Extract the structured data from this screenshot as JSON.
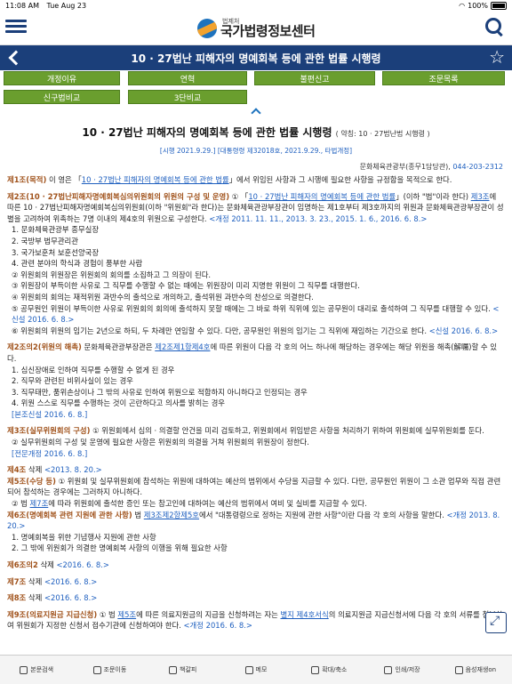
{
  "status": {
    "time": "11:08 AM",
    "date": "Tue Aug 23",
    "battery": "100%"
  },
  "header": {
    "logo_sub": "법제처",
    "logo_main": "국가법령정보센터"
  },
  "titlebar": {
    "title": "10 · 27법난 피해자의 명예회복 등에 관한 법률 시행령"
  },
  "tabs": [
    {
      "label": "개정이유"
    },
    {
      "label": "연혁"
    },
    {
      "label": "불편신고"
    },
    {
      "label": "조문목록"
    },
    {
      "label": "신구법비교"
    },
    {
      "label": "3단비교"
    }
  ],
  "doc": {
    "title": "10 · 27법난 피해자의 명예회복 등에 관한 법률 시행령",
    "abbr": "( 약칭: 10 · 27법난법 시행령 )",
    "enact": "[시행 2021.9.29.] [대통령령 제32018호, 2021.9.29., 타법개정]",
    "ministry": "문화체육관광부(종무1담당관),",
    "tel": "044-203-2312"
  },
  "articles": {
    "a1_head": "제1조(목적)",
    "a1_t1": " 이 영은 「",
    "a1_link": "10 · 27법난 피해자의 명예회복 등에 관한 법률",
    "a1_t2": "」에서 위임된 사항과 그 시행에 필요한 사항을 규정함을 목적으로 한다.",
    "a2_head": "제2조(10 · 27법난피해자명예회복심의위원회의 위원의 구성 및 운영)",
    "a2_t1": " ① 「",
    "a2_link": "10 · 27법난 피해자의 명예회복 등에 관한 법률",
    "a2_t2": "」(이하 \"법\"이라 한다) ",
    "a2_link2": "제3조",
    "a2_t3": "에 따른 10 · 27법난피해자명예회복심의위원회(이하 \"위원회\"라 한다)는 문화체육관광부장관이 임명하는 제1호부터 제3호까지의 위원과 문화체육관광부장관이 성별을 고려하여 위촉하는 7명 이내의 제4호의 위원으로 구성한다.",
    "a2_amd": " <개정 2011. 11. 11., 2013. 3. 23., 2015. 1. 6., 2016. 6. 8.>",
    "a2_i1": "1. 문화체육관광부 종무실장",
    "a2_i2": "2. 국방부 법무관리관",
    "a2_i3": "3. 국가보훈처 보훈선양국장",
    "a2_i4": "4. 관련 분야의 학식과 경험이 풍부한 사람",
    "a2_p2": "② 위원회의 위원장은 위원회의 회의를 소집하고 그 의장이 된다.",
    "a2_p3": "③ 위원장이 부득이한 사유로 그 직무를 수행할 수 없는 때에는 위원장이 미리 지명한 위원이 그 직무를 대행한다.",
    "a2_p4": "④ 위원회의 회의는 재적위원 과반수의 출석으로 개의하고, 출석위원 과반수의 찬성으로 의결한다.",
    "a2_p5": "⑤ 공무원인 위원이 부득이한 사유로 위원회의 회의에 출석하지 못할 때에는 그 바로 하위 직위에 있는 공무원이 대리로 출석하여 그 직무를 대행할 수 있다.",
    "a2_p5_amd": " <신설 2016. 6. 8.>",
    "a2_p6": "⑥ 위원회의 위원의 임기는 2년으로 하되, 두 차례만 연임할 수 있다. 다만, 공무원인 위원의 임기는 그 직위에 재임하는 기간으로 한다.",
    "a2_p6_amd": " <신설 2016. 6. 8.>",
    "a22_head": "제2조의2(위원의 해촉)",
    "a22_t1": " 문화체육관광부장관은 ",
    "a22_link": "제2조제1항제4호",
    "a22_t2": "에 따른 위원이 다음 각 호의 어느 하나에 해당하는 경우에는 해당 위원을 해촉(解囑)할 수 있다.",
    "a22_i1": "1. 심신장애로 인하여 직무를 수행할 수 없게 된 경우",
    "a22_i2": "2. 직무와 관련된 비위사실이 있는 경우",
    "a22_i3": "3. 직무태만, 품위손상이나 그 밖의 사유로 인하여 위원으로 적합하지 아니하다고 인정되는 경우",
    "a22_i4": "4. 위원 스스로 직무를 수행하는 것이 곤란하다고 의사를 밝히는 경우",
    "a22_amd": "[본조신설 2016. 6. 8.]",
    "a3_head": "제3조(실무위원회의 구성)",
    "a3_t1": " ① 위원회에서 심의 · 의결할 안건을 미리 검토하고, 위원회에서 위임받은 사항을 처리하기 위하여 위원회에 실무위원회를 둔다.",
    "a3_p2": "② 실무위원회의 구성 및 운영에 필요한 사항은 위원회의 의결을 거쳐 위원회의 위원장이 정한다.",
    "a3_amd": "[전문개정 2016. 6. 8.]",
    "a4_head": "제4조",
    "a4_t1": " 삭제 ",
    "a4_amd": "<2013. 8. 20.>",
    "a5_head": "제5조(수당 등)",
    "a5_t1": " ① 위원회 및 실무위원회에 참석하는 위원에 대하여는 예산의 범위에서 수당을 지급할 수 있다. 다만, 공무원인 위원이 그 소관 업무와 직접 관련되어 참석하는 경우에는 그러하지 아니하다.",
    "a5_t2": "② 법 ",
    "a5_link": "제7조",
    "a5_t3": "에 따라 위원회에 출석한 증인 또는 참고인에 대하여는 예산의 범위에서 여비 및 실비를 지급할 수 있다.",
    "a6_head": "제6조(명예회복 관련 지원에 관한 사항)",
    "a6_t1": " 법 ",
    "a6_link": "제3조제2항제5호",
    "a6_t2": "에서 \"대통령령으로 정하는 지원에 관한 사항\"이란 다음 각 호의 사항을 말한다.",
    "a6_amd": " <개정 2013. 8. 20.>",
    "a6_i1": "1. 명예회복을 위한 기념행사 지원에 관한 사항",
    "a6_i2": "2. 그 밖에 위원회가 의결한 명예회복 사항의 이행을 위해 필요한 사항",
    "a62_head": "제6조의2",
    "a62_t1": " 삭제 ",
    "a62_amd": "<2016. 6. 8.>",
    "a7_head": "제7조",
    "a7_t1": " 삭제 ",
    "a7_amd": "<2016. 6. 8.>",
    "a8_head": "제8조",
    "a8_t1": " 삭제 ",
    "a8_amd": "<2016. 6. 8.>",
    "a9_head": "제9조(의료지원금 지급신청)",
    "a9_t1": " ① 법 ",
    "a9_link": "제5조",
    "a9_t2": "에 따른 의료지원금의 지급을 신청하려는 자는 ",
    "a9_link2": "별지 제4호서식",
    "a9_t3": "의 의료지원금 지급신청서에 다음 각 호의 서류를 첨부하여 위원회가 지정한 신청서 접수기관에 신청하여야 한다.",
    "a9_amd": " <개정 2016. 6. 8.>"
  },
  "bottom": [
    {
      "label": "본문검색"
    },
    {
      "label": "조문이동"
    },
    {
      "label": "책갈피"
    },
    {
      "label": "메모"
    },
    {
      "label": "확대/축소"
    },
    {
      "label": "인쇄/저장"
    },
    {
      "label": "음성재생on"
    }
  ]
}
